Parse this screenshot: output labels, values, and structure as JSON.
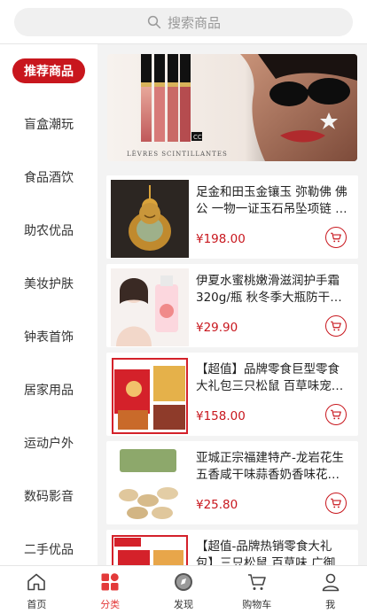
{
  "search": {
    "placeholder": "搜索商品"
  },
  "sidebar": {
    "items": [
      {
        "label": "推荐商品",
        "active": true
      },
      {
        "label": "盲盒潮玩"
      },
      {
        "label": "食品酒饮"
      },
      {
        "label": "助农优品"
      },
      {
        "label": "美妆护肤"
      },
      {
        "label": "钟表首饰"
      },
      {
        "label": "居家用品"
      },
      {
        "label": "运动户外"
      },
      {
        "label": "数码影音"
      },
      {
        "label": "二手优品"
      }
    ]
  },
  "banner": {
    "caption": "LÈVRES SCINTILLANTES"
  },
  "products": [
    {
      "title": "足金和田玉金镶玉 弥勒佛 佛公 一物一证玉石吊坠项链 男女款",
      "price": "¥198.00"
    },
    {
      "title": "伊夏水蜜桃嫩滑滋润护手霜320g/瓶 秋冬季大瓶防干裂补水保湿",
      "price": "¥29.90"
    },
    {
      "title": "【超值】品牌零食巨型零食大礼包三只松鼠 百草味宠爱零食礼盒",
      "price": "¥158.00"
    },
    {
      "title": "亚城正宗福建特产-龙岩花生五香咸干味蒜香奶香味花生零食",
      "price": "¥25.80"
    },
    {
      "title": "【超值-品牌热销零食大礼包】三只松鼠 百草味 广御园休闲零食",
      "price": ""
    }
  ],
  "tabbar": {
    "items": [
      {
        "label": "首页",
        "icon": "home-icon"
      },
      {
        "label": "分类",
        "icon": "category-icon",
        "active": true
      },
      {
        "label": "发现",
        "icon": "discover-icon"
      },
      {
        "label": "购物车",
        "icon": "cart-icon"
      },
      {
        "label": "我",
        "icon": "user-icon"
      }
    ]
  },
  "colors": {
    "accent": "#c8161d",
    "tab_active": "#e33a3a",
    "background": "#f3f3f3"
  }
}
